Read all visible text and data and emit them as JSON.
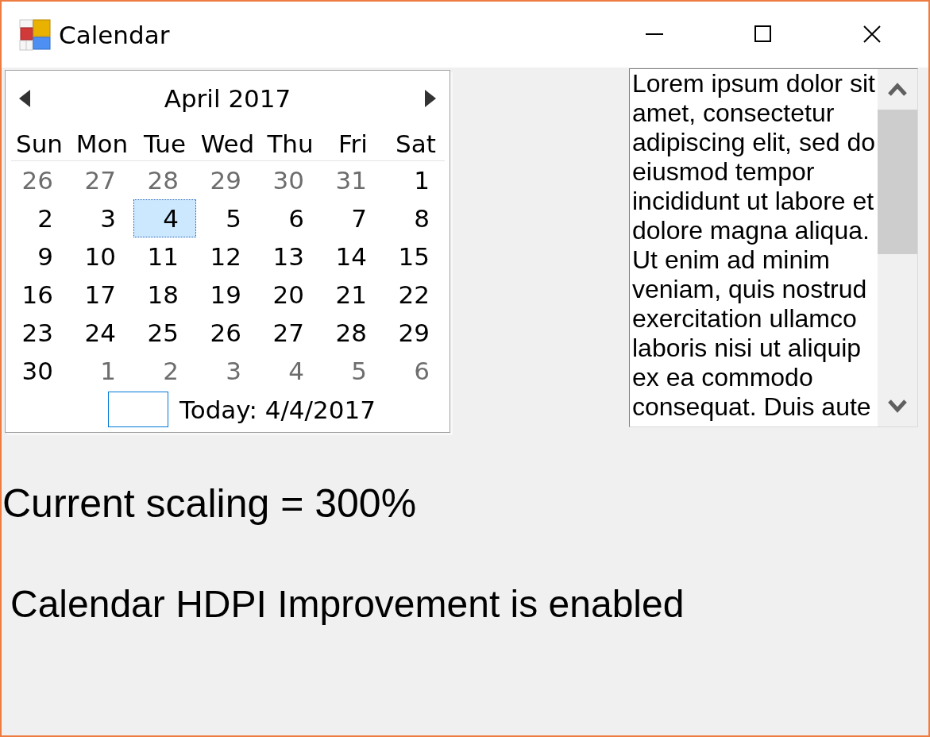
{
  "window": {
    "title": "Calendar"
  },
  "calendar": {
    "month_title": "April 2017",
    "weekdays": [
      "Sun",
      "Mon",
      "Tue",
      "Wed",
      "Thu",
      "Fri",
      "Sat"
    ],
    "weeks": [
      [
        {
          "day": "26",
          "other_month": true,
          "selected": false
        },
        {
          "day": "27",
          "other_month": true,
          "selected": false
        },
        {
          "day": "28",
          "other_month": true,
          "selected": false
        },
        {
          "day": "29",
          "other_month": true,
          "selected": false
        },
        {
          "day": "30",
          "other_month": true,
          "selected": false
        },
        {
          "day": "31",
          "other_month": true,
          "selected": false
        },
        {
          "day": "1",
          "other_month": false,
          "selected": false
        }
      ],
      [
        {
          "day": "2",
          "other_month": false,
          "selected": false
        },
        {
          "day": "3",
          "other_month": false,
          "selected": false
        },
        {
          "day": "4",
          "other_month": false,
          "selected": true
        },
        {
          "day": "5",
          "other_month": false,
          "selected": false
        },
        {
          "day": "6",
          "other_month": false,
          "selected": false
        },
        {
          "day": "7",
          "other_month": false,
          "selected": false
        },
        {
          "day": "8",
          "other_month": false,
          "selected": false
        }
      ],
      [
        {
          "day": "9",
          "other_month": false,
          "selected": false
        },
        {
          "day": "10",
          "other_month": false,
          "selected": false
        },
        {
          "day": "11",
          "other_month": false,
          "selected": false
        },
        {
          "day": "12",
          "other_month": false,
          "selected": false
        },
        {
          "day": "13",
          "other_month": false,
          "selected": false
        },
        {
          "day": "14",
          "other_month": false,
          "selected": false
        },
        {
          "day": "15",
          "other_month": false,
          "selected": false
        }
      ],
      [
        {
          "day": "16",
          "other_month": false,
          "selected": false
        },
        {
          "day": "17",
          "other_month": false,
          "selected": false
        },
        {
          "day": "18",
          "other_month": false,
          "selected": false
        },
        {
          "day": "19",
          "other_month": false,
          "selected": false
        },
        {
          "day": "20",
          "other_month": false,
          "selected": false
        },
        {
          "day": "21",
          "other_month": false,
          "selected": false
        },
        {
          "day": "22",
          "other_month": false,
          "selected": false
        }
      ],
      [
        {
          "day": "23",
          "other_month": false,
          "selected": false
        },
        {
          "day": "24",
          "other_month": false,
          "selected": false
        },
        {
          "day": "25",
          "other_month": false,
          "selected": false
        },
        {
          "day": "26",
          "other_month": false,
          "selected": false
        },
        {
          "day": "27",
          "other_month": false,
          "selected": false
        },
        {
          "day": "28",
          "other_month": false,
          "selected": false
        },
        {
          "day": "29",
          "other_month": false,
          "selected": false
        }
      ],
      [
        {
          "day": "30",
          "other_month": false,
          "selected": false
        },
        {
          "day": "1",
          "other_month": true,
          "selected": false
        },
        {
          "day": "2",
          "other_month": true,
          "selected": false
        },
        {
          "day": "3",
          "other_month": true,
          "selected": false
        },
        {
          "day": "4",
          "other_month": true,
          "selected": false
        },
        {
          "day": "5",
          "other_month": true,
          "selected": false
        },
        {
          "day": "6",
          "other_month": true,
          "selected": false
        }
      ]
    ],
    "today_label": "Today: 4/4/2017"
  },
  "text_box": {
    "text": "Lorem ipsum dolor sit amet, consectetur adipiscing elit, sed do eiusmod tempor incididunt ut labore et dolore magna aliqua. Ut enim ad minim veniam, quis nostrud exercitation ullamco laboris nisi ut aliquip ex ea commodo consequat. Duis aute"
  },
  "labels": [
    {
      "kind": "heading",
      "text": "Current scaling = 300%"
    },
    {
      "kind": "status",
      "text": "Calendar HDPI Improvement is enabled"
    }
  ]
}
